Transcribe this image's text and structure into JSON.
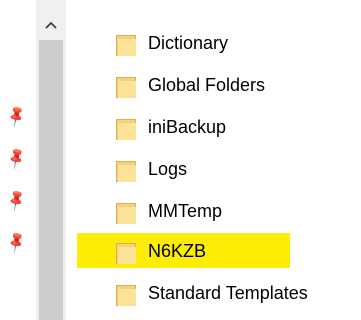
{
  "scrollbar": {
    "up_arrow": "chevron-up-icon"
  },
  "pins": [
    "pin-icon",
    "pin-icon",
    "pin-icon",
    "pin-icon"
  ],
  "folders": [
    {
      "name": "Dictionary"
    },
    {
      "name": "Global Folders"
    },
    {
      "name": "iniBackup"
    },
    {
      "name": "Logs"
    },
    {
      "name": "MMTemp"
    },
    {
      "name": "N6KZB"
    },
    {
      "name": "Standard Templates"
    }
  ],
  "selected_folder": "N6KZB",
  "colors": {
    "highlight": "#fcec06",
    "folder_fill": "#f5d27a",
    "scrollbar_track": "#f0f0f0",
    "scrollbar_thumb": "#cdcdcd",
    "pin": "#8c8c8c"
  }
}
